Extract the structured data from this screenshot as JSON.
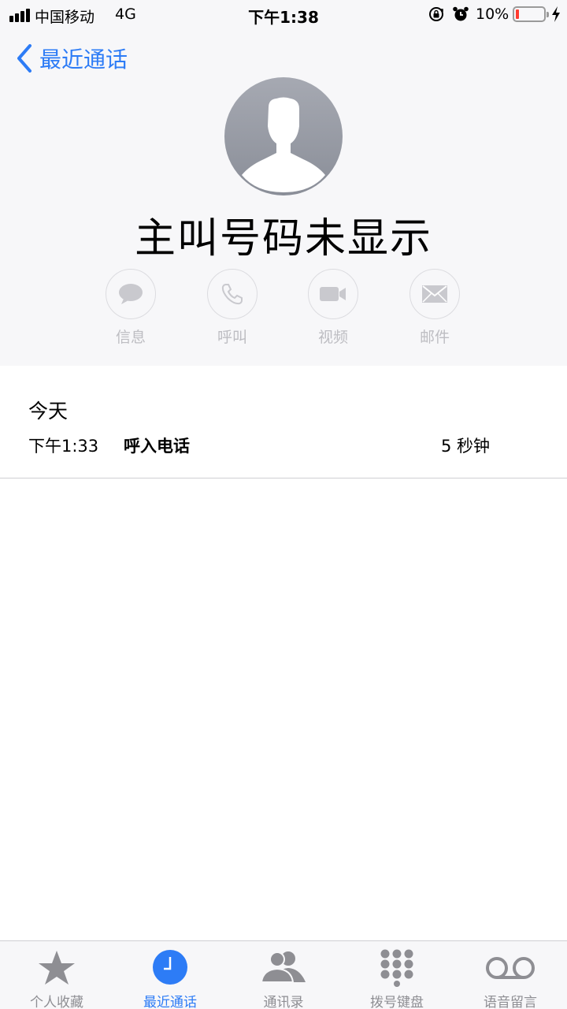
{
  "status_bar": {
    "carrier": "中国移动",
    "network": "4G",
    "time": "下午1:38",
    "battery_percent": "10%",
    "battery_level": 0.1,
    "icons": [
      "signal-icon",
      "rotation-lock-icon",
      "alarm-icon",
      "battery-icon",
      "charging-bolt-icon"
    ]
  },
  "nav": {
    "back_label": "最近通话"
  },
  "contact": {
    "name": "主叫号码未显示",
    "actions": [
      {
        "label": "信息",
        "icon": "message-icon"
      },
      {
        "label": "呼叫",
        "icon": "phone-icon"
      },
      {
        "label": "视频",
        "icon": "video-icon"
      },
      {
        "label": "邮件",
        "icon": "mail-icon"
      }
    ]
  },
  "calls": {
    "section_title": "今天",
    "entries": [
      {
        "time": "下午1:33",
        "type": "呼入电话",
        "duration": "5 秒钟"
      }
    ]
  },
  "tabbar": {
    "tabs": [
      {
        "label": "个人收藏",
        "icon": "star-icon",
        "active": false
      },
      {
        "label": "最近通话",
        "icon": "clock-icon",
        "active": true
      },
      {
        "label": "通讯录",
        "icon": "contacts-icon",
        "active": false
      },
      {
        "label": "拨号键盘",
        "icon": "keypad-icon",
        "active": false
      },
      {
        "label": "语音留言",
        "icon": "voicemail-icon",
        "active": false
      }
    ]
  },
  "colors": {
    "accent": "#2d7cf6",
    "header_bg": "#f7f7f9",
    "disabled_action": "#bdbdc2",
    "battery_low": "#ff3b30"
  }
}
